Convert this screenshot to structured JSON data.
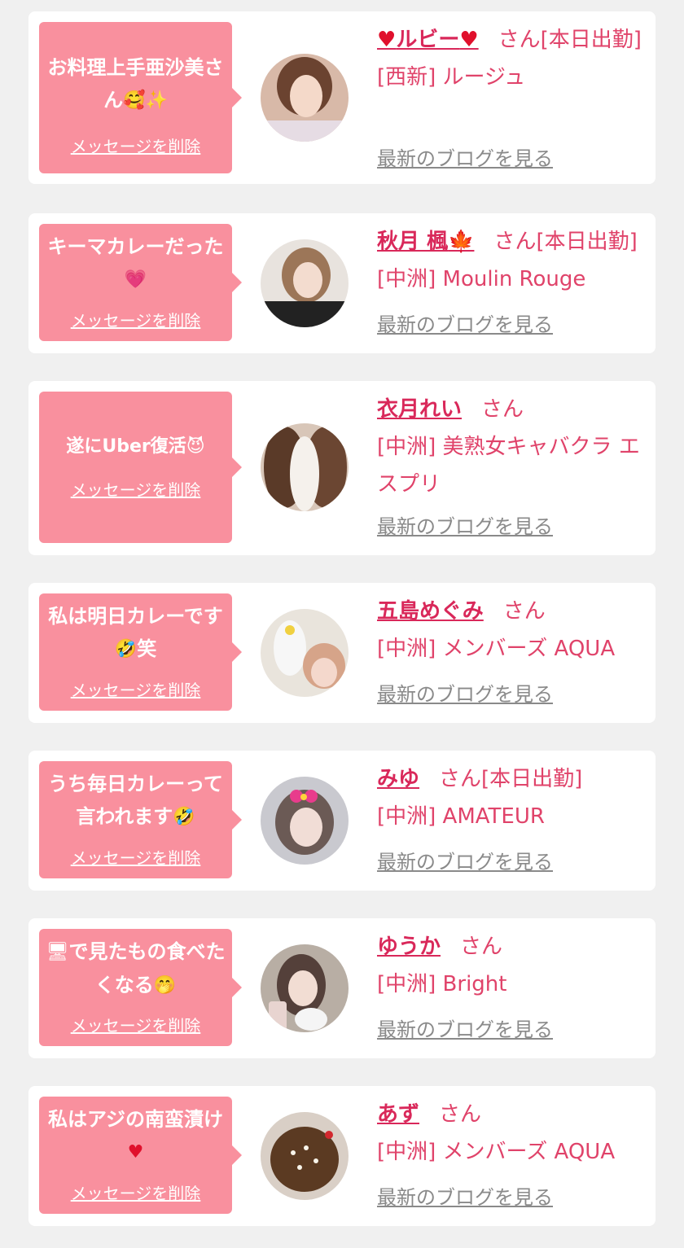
{
  "delete_label": "メッセージを削除",
  "blog_label": "最新のブログを見る",
  "colors": {
    "page_bg": "#f0f0f0",
    "bubble": "#f9909e",
    "name": "#d9285a",
    "info": "#e0436a",
    "blog_link": "#8a8a8a"
  },
  "entries": [
    {
      "message": "お料理上手亜沙美さん",
      "emoji": "🥰✨",
      "name_prefix": "♥",
      "name": "ルビー",
      "name_suffix": "♥",
      "honorific": "さん[本日出勤]",
      "shop": "[西新] ルージュ",
      "avatar": "avatar-photo"
    },
    {
      "message": "キーマカレーだった",
      "emoji": "💗",
      "name": "秋月 楓",
      "name_suffix": "🍁",
      "honorific": "さん[本日出勤]",
      "shop": "[中洲] Moulin Rouge",
      "avatar": "avatar-photo"
    },
    {
      "message": "遂にUber復活",
      "emoji": "😈",
      "name": "衣月れい",
      "honorific": "さん",
      "shop": "[中洲] 美熟女キャバクラ エスプリ",
      "avatar": "avatar-photo"
    },
    {
      "message": "私は明日カレーです",
      "emoji": "🤣",
      "message_after": "笑",
      "name": "五島めぐみ",
      "honorific": "さん",
      "shop": "[中洲] メンバーズ AQUA",
      "avatar": "avatar-photo"
    },
    {
      "message": "うち毎日カレーって言われます",
      "emoji": "🤣",
      "name": "みゆ",
      "honorific": "さん[本日出勤]",
      "shop": "[中洲] AMATEUR",
      "avatar": "avatar-photo"
    },
    {
      "message_before_emoji": "🖥",
      "message": "で見たもの食べたくなる",
      "emoji": "🤭",
      "name": "ゆうか",
      "honorific": "さん",
      "shop": "[中洲] Bright",
      "avatar": "avatar-photo"
    },
    {
      "message": "私はアジの南蛮漬け",
      "emoji": "♥",
      "name": "あず",
      "honorific": "さん",
      "shop": "[中洲] メンバーズ AQUA",
      "avatar": "avatar-photo"
    }
  ]
}
